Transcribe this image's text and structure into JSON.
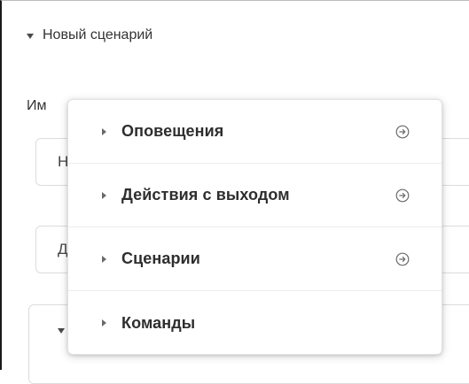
{
  "section": {
    "title": "Новый сценарий"
  },
  "form": {
    "name_label": "Им",
    "field_1_text": "Н",
    "field_2_text": "Д"
  },
  "menu": {
    "items": [
      {
        "label": "Оповещения",
        "has_arrow": true,
        "icon": "arrow-right-circle-icon"
      },
      {
        "label": "Действия с выходом",
        "has_arrow": true,
        "icon": "arrow-right-circle-icon"
      },
      {
        "label": "Сценарии",
        "has_arrow": true,
        "icon": "arrow-right-circle-icon"
      },
      {
        "label": "Команды",
        "has_arrow": false
      }
    ]
  },
  "colors": {
    "text": "#2e2e2e",
    "border": "#dcdcdc",
    "icon": "#6a6a6a"
  }
}
